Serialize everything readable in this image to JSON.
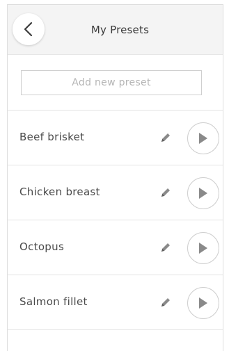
{
  "header": {
    "title": "My Presets",
    "back_icon": "chevron-left-icon"
  },
  "add_preset": {
    "label": "Add new preset"
  },
  "presets": [
    {
      "label": "Beef brisket",
      "edit_icon": "pencil-icon",
      "play_icon": "play-icon"
    },
    {
      "label": "Chicken breast",
      "edit_icon": "pencil-icon",
      "play_icon": "play-icon"
    },
    {
      "label": "Octopus",
      "edit_icon": "pencil-icon",
      "play_icon": "play-icon"
    },
    {
      "label": "Salmon fillet",
      "edit_icon": "pencil-icon",
      "play_icon": "play-icon"
    }
  ],
  "colors": {
    "header_bg": "#f4f4f4",
    "text": "#4a4a4a",
    "placeholder_text": "#b5b5b5",
    "border": "#cfcfcf",
    "icon": "#8a8a8a"
  }
}
